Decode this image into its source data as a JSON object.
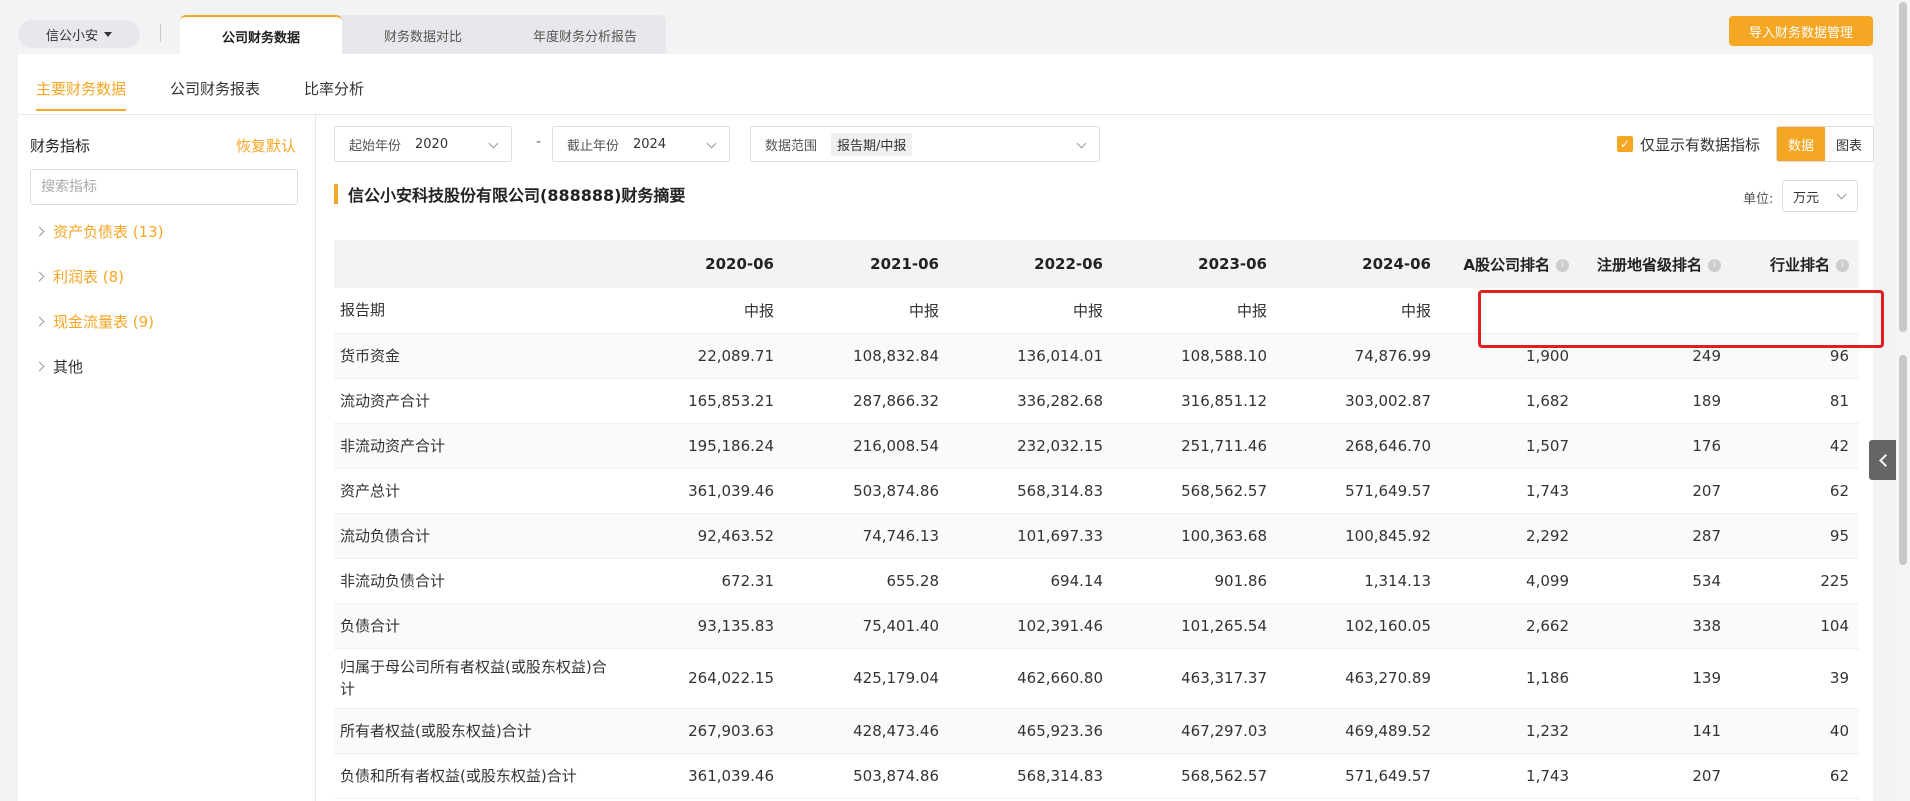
{
  "company": {
    "name": "信公小安"
  },
  "top_tabs": [
    "公司财务数据",
    "财务数据对比",
    "年度财务分析报告"
  ],
  "import_button": "导入财务数据管理",
  "sub_tabs": [
    "主要财务数据",
    "公司财务报表",
    "比率分析"
  ],
  "sidebar": {
    "title": "财务指标",
    "reset": "恢复默认",
    "search_placeholder": "搜索指标",
    "items": [
      {
        "label": "资产负债表 (13)"
      },
      {
        "label": "利润表 (8)"
      },
      {
        "label": "现金流量表 (9)"
      },
      {
        "label": "其他"
      }
    ]
  },
  "filters": {
    "start_label": "起始年份",
    "start_value": "2020",
    "end_label": "截止年份",
    "end_value": "2024",
    "range_label": "数据范围",
    "range_value": "报告期/中报",
    "only_label": "仅显示有数据指标",
    "view_data": "数据",
    "view_chart": "图表"
  },
  "summary": {
    "title": "信公小安科技股份有限公司(888888)财务摘要",
    "unit_label": "单位:",
    "unit_value": "万元"
  },
  "table": {
    "columns": [
      "",
      "2020-06",
      "2021-06",
      "2022-06",
      "2023-06",
      "2024-06",
      "A股公司排名",
      "注册地省级排名",
      "行业排名"
    ],
    "rows": [
      [
        "报告期",
        "中报",
        "中报",
        "中报",
        "中报",
        "中报",
        "",
        "",
        ""
      ],
      [
        "货币资金",
        "22,089.71",
        "108,832.84",
        "136,014.01",
        "108,588.10",
        "74,876.99",
        "1,900",
        "249",
        "96"
      ],
      [
        "流动资产合计",
        "165,853.21",
        "287,866.32",
        "336,282.68",
        "316,851.12",
        "303,002.87",
        "1,682",
        "189",
        "81"
      ],
      [
        "非流动资产合计",
        "195,186.24",
        "216,008.54",
        "232,032.15",
        "251,711.46",
        "268,646.70",
        "1,507",
        "176",
        "42"
      ],
      [
        "资产总计",
        "361,039.46",
        "503,874.86",
        "568,314.83",
        "568,562.57",
        "571,649.57",
        "1,743",
        "207",
        "62"
      ],
      [
        "流动负债合计",
        "92,463.52",
        "74,746.13",
        "101,697.33",
        "100,363.68",
        "100,845.92",
        "2,292",
        "287",
        "95"
      ],
      [
        "非流动负债合计",
        "672.31",
        "655.28",
        "694.14",
        "901.86",
        "1,314.13",
        "4,099",
        "534",
        "225"
      ],
      [
        "负债合计",
        "93,135.83",
        "75,401.40",
        "102,391.46",
        "101,265.54",
        "102,160.05",
        "2,662",
        "338",
        "104"
      ],
      [
        "归属于母公司所有者权益(或股东权益)合计",
        "264,022.15",
        "425,179.04",
        "462,660.80",
        "463,317.37",
        "463,270.89",
        "1,186",
        "139",
        "39"
      ],
      [
        "所有者权益(或股东权益)合计",
        "267,903.63",
        "428,473.46",
        "465,923.36",
        "467,297.03",
        "469,489.52",
        "1,232",
        "141",
        "40"
      ],
      [
        "负债和所有者权益(或股东权益)合计",
        "361,039.46",
        "503,874.86",
        "568,314.83",
        "568,562.57",
        "571,649.57",
        "1,743",
        "207",
        "62"
      ]
    ]
  }
}
